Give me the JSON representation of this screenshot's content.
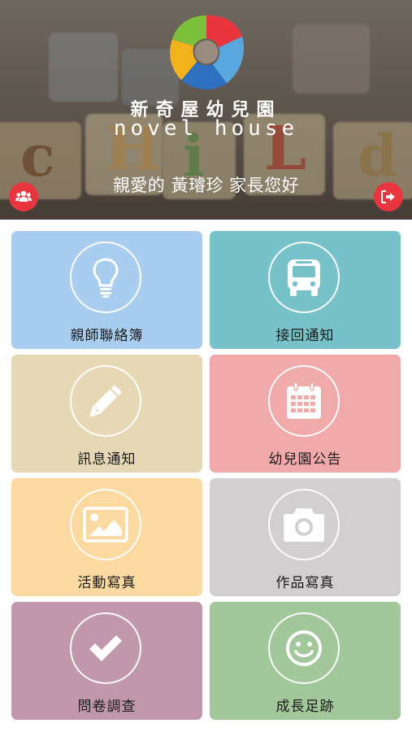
{
  "header": {
    "brand_chinese": "新奇屋幼兒園",
    "brand_english": "novel house",
    "greeting": "親愛的 黃璿珍 家長您好",
    "left_button_icon": "group-icon",
    "right_button_icon": "logout-icon",
    "button_color": "#e8353e"
  },
  "tiles": [
    {
      "label": "親師聯絡簿",
      "icon": "lightbulb-icon",
      "color": "#a9cdef"
    },
    {
      "label": "接回通知",
      "icon": "bus-icon",
      "color": "#77c2c8"
    },
    {
      "label": "訊息通知",
      "icon": "pencil-icon",
      "color": "#e6d8b4"
    },
    {
      "label": "幼兒園公告",
      "icon": "calendar-icon",
      "color": "#f0aaaa"
    },
    {
      "label": "活動寫真",
      "icon": "image-icon",
      "color": "#fcd9a1"
    },
    {
      "label": "作品寫真",
      "icon": "camera-icon",
      "color": "#d3cfd1"
    },
    {
      "label": "問卷調查",
      "icon": "checkmark-icon",
      "color": "#c197ac"
    },
    {
      "label": "成長足跡",
      "icon": "smile-icon",
      "color": "#a1c79a"
    }
  ]
}
